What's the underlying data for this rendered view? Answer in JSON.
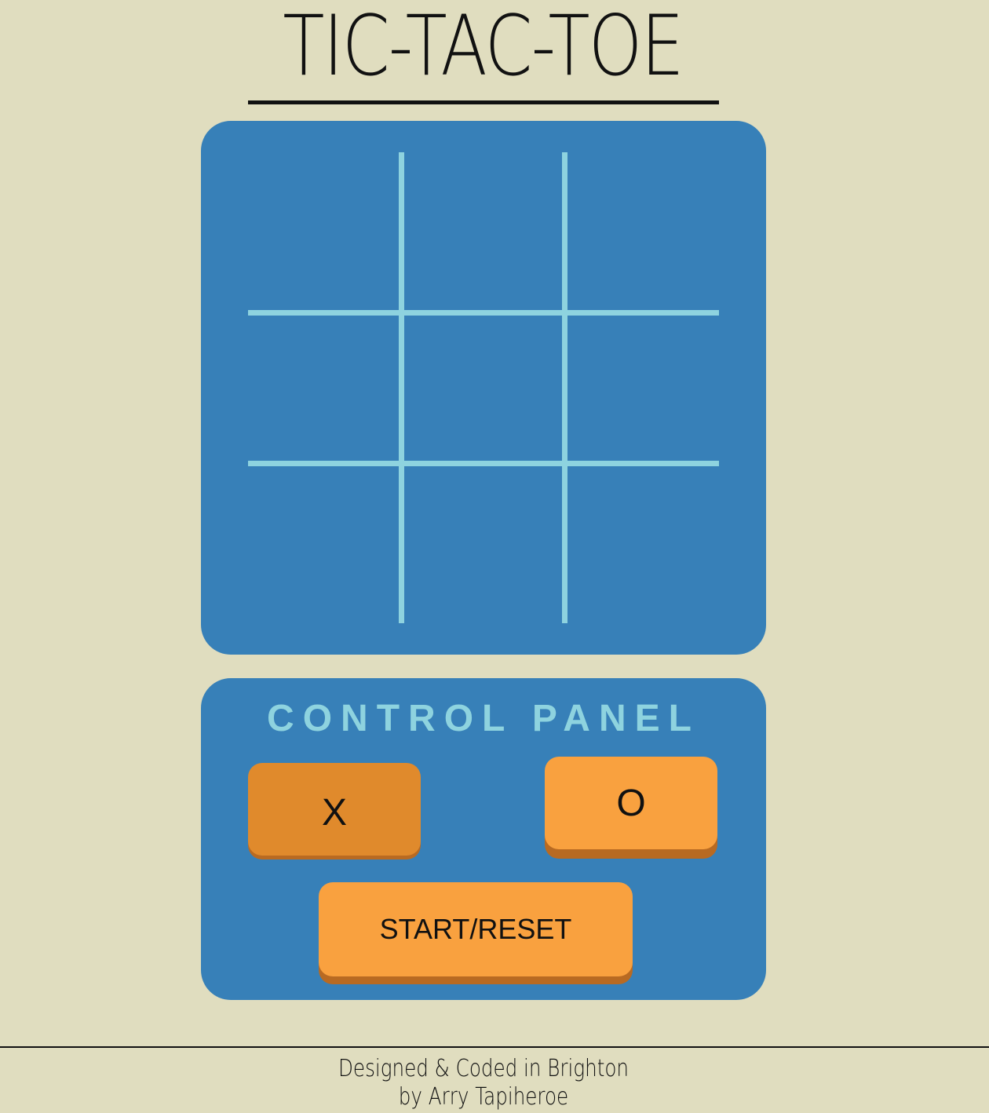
{
  "header": {
    "title": "TIC-TAC-TOE"
  },
  "board": {
    "cells": [
      "",
      "",
      "",
      "",
      "",
      "",
      "",
      "",
      ""
    ],
    "line_color": "#8ed3df",
    "background_color": "#3780b8"
  },
  "control_panel": {
    "title": "CONTROL PANEL",
    "x_button_label": "X",
    "o_button_label": "O",
    "reset_button_label": "START/RESET",
    "selected_player": "X"
  },
  "footer": {
    "line1": "Designed & Coded in Brighton",
    "line2": "by Arry Tapiheroe"
  },
  "colors": {
    "page_background": "#e0ddbf",
    "button_orange": "#f9a13f",
    "button_orange_active": "#e08a2c",
    "button_shadow": "#b86a22",
    "accent_light_blue": "#8ed3df"
  }
}
